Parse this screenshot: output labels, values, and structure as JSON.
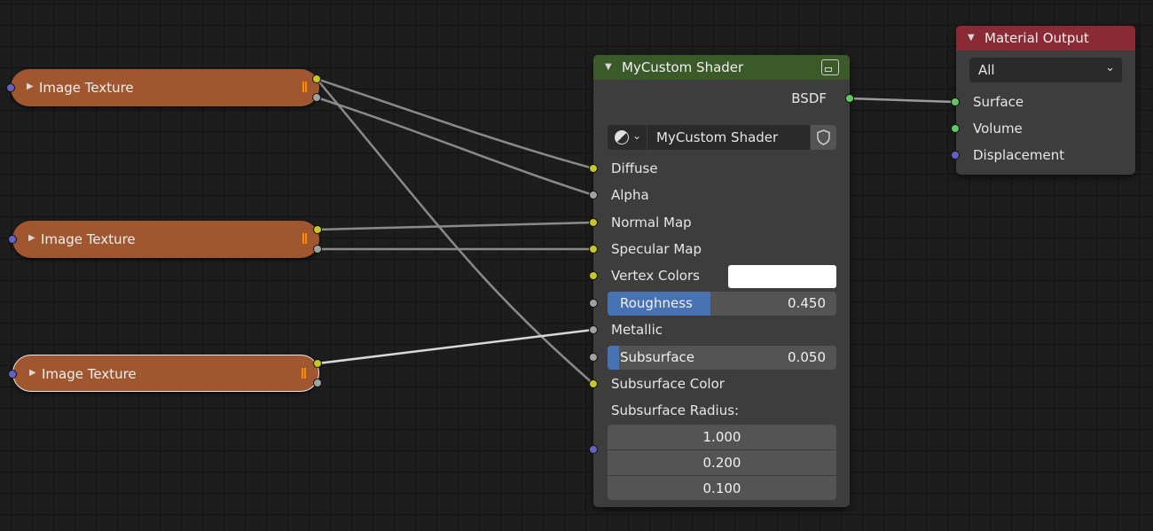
{
  "texture_nodes": [
    {
      "title": "Image Texture"
    },
    {
      "title": "Image Texture"
    },
    {
      "title": "Image Texture"
    }
  ],
  "shader_node": {
    "title": "MyCustom Shader",
    "output_bsdf": "BSDF",
    "node_group_name": "MyCustom Shader",
    "inputs": {
      "diffuse": "Diffuse",
      "alpha": "Alpha",
      "normal_map": "Normal Map",
      "specular_map": "Specular Map",
      "vertex_colors": "Vertex Colors",
      "metallic": "Metallic",
      "subsurface_color": "Subsurface Color",
      "subsurface_radius": "Subsurface Radius:"
    },
    "vertex_color_value": "#ffffff",
    "roughness": {
      "label": "Roughness",
      "value": "0.450",
      "fraction": 0.45
    },
    "subsurface": {
      "label": "Subsurface",
      "value": "0.050",
      "fraction": 0.05
    },
    "subsurface_radius_values": [
      "1.000",
      "0.200",
      "0.100"
    ]
  },
  "material_output": {
    "title": "Material Output",
    "target": "All",
    "inputs": {
      "surface": "Surface",
      "volume": "Volume",
      "displacement": "Displacement"
    }
  },
  "colors": {
    "texture_node": "#a0562e",
    "group_header": "#3b5a2a",
    "output_header": "#8a2a34",
    "socket_color": "#c7c729",
    "socket_float": "#a1a1a1",
    "socket_shader": "#63c763",
    "socket_vector": "#6363c7",
    "slider_fill": "#4772b3"
  }
}
